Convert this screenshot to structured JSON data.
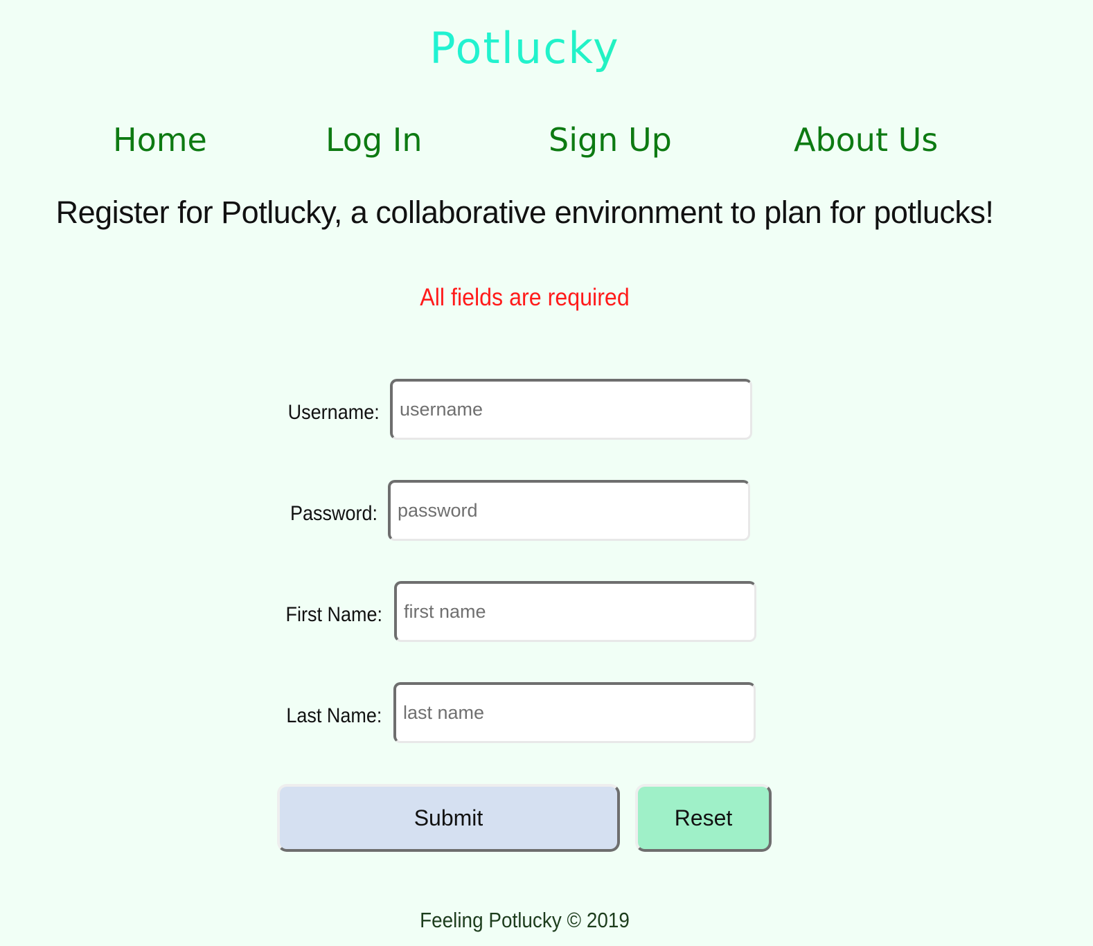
{
  "site": {
    "title": "Potlucky"
  },
  "nav": {
    "items": [
      {
        "label": "Home"
      },
      {
        "label": "Log In"
      },
      {
        "label": "Sign Up"
      },
      {
        "label": "About Us"
      }
    ]
  },
  "intro": {
    "text": "Register for Potlucky, a collaborative environment to plan for potlucks!"
  },
  "form": {
    "required_note": "All fields are required",
    "fields": [
      {
        "label": "Username:",
        "placeholder": "username",
        "value": ""
      },
      {
        "label": "Password:",
        "placeholder": "password",
        "value": ""
      },
      {
        "label": "First Name:",
        "placeholder": "first name",
        "value": ""
      },
      {
        "label": "Last Name:",
        "placeholder": "last name",
        "value": ""
      }
    ],
    "submit_label": "Submit",
    "reset_label": "Reset"
  },
  "footer": {
    "text": "Feeling Potlucky © 2019"
  },
  "colors": {
    "background": "#f1fff6",
    "nav_link": "#0d7a12",
    "required_note": "#ff1a1a",
    "submit_button": "#d5e0f1",
    "reset_button": "#9ff0c8",
    "title_gradient_start": "#1ff0f0",
    "title_gradient_end": "#2ee86a"
  }
}
